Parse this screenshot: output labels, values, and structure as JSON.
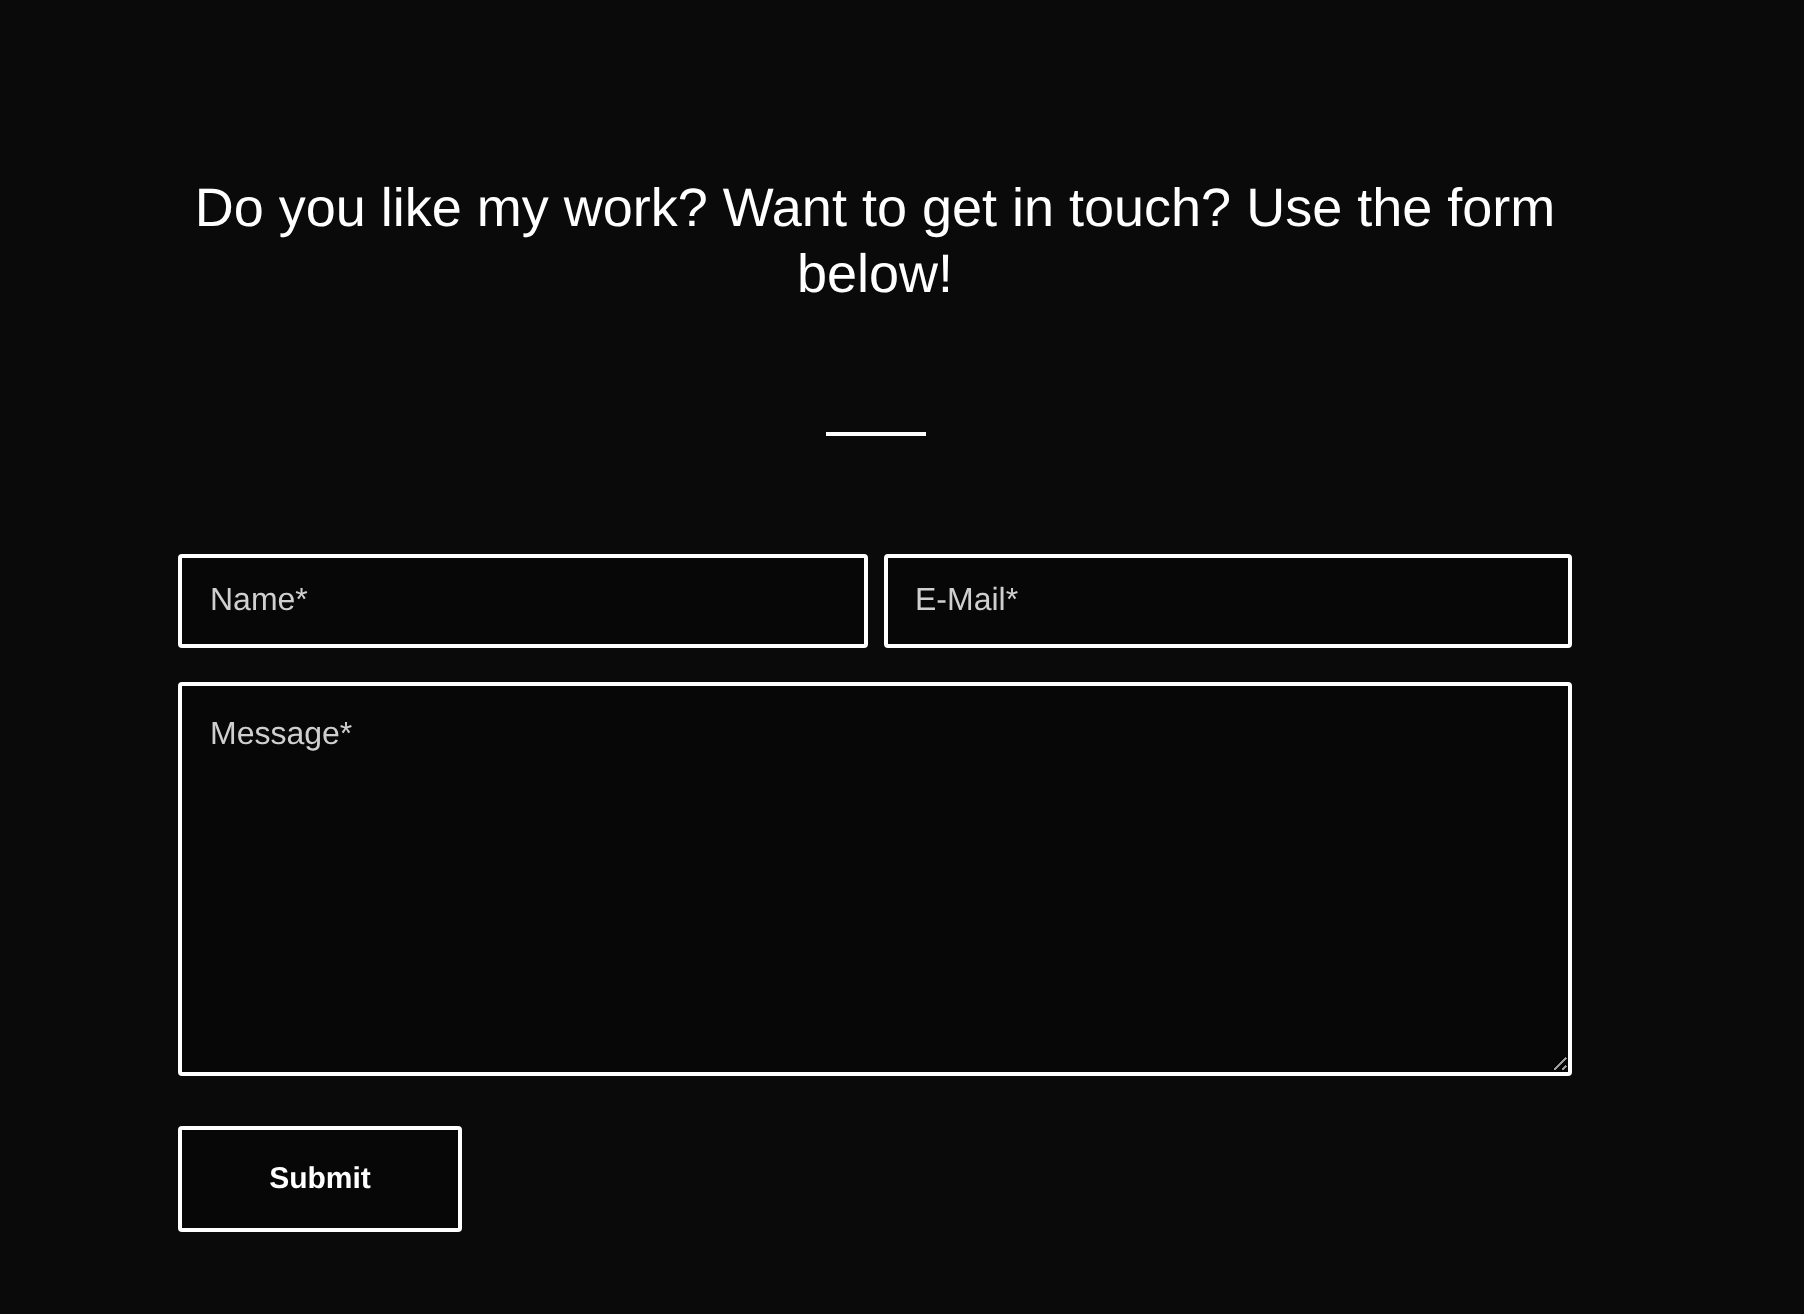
{
  "heading": "Do you like my work? Want to get in touch? Use the form below!",
  "form": {
    "name": {
      "placeholder": "Name*"
    },
    "email": {
      "placeholder": "E-Mail*"
    },
    "message": {
      "placeholder": "Message*"
    },
    "submit": "Submit"
  }
}
